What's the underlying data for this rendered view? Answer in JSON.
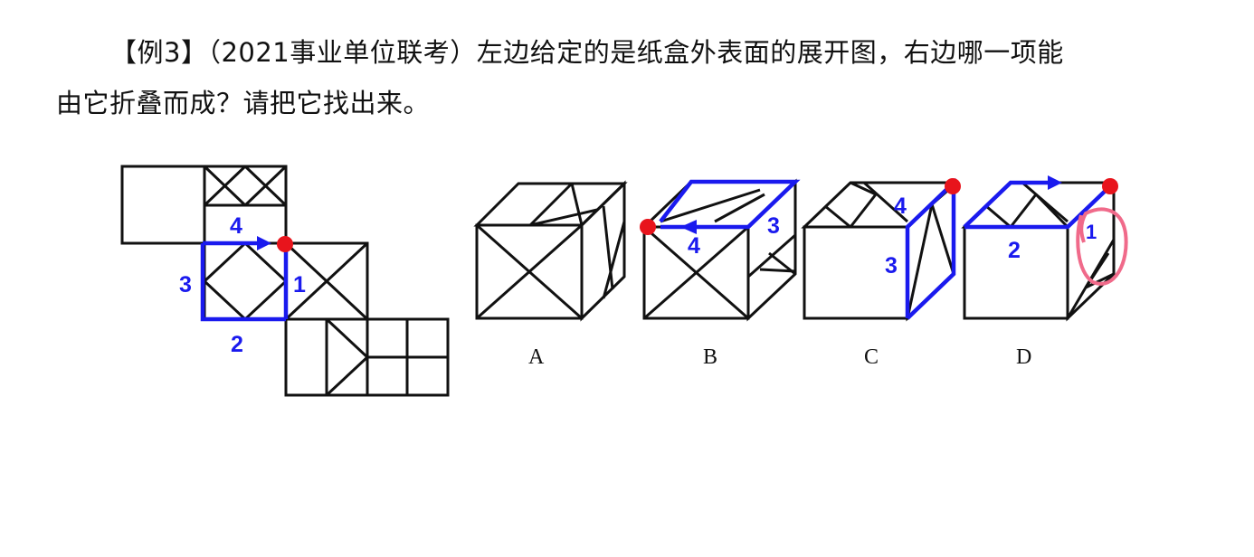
{
  "question": {
    "example_tag": "【例3】",
    "source": "（2021事业单位联考）",
    "text_line1": "左边给定的是纸盒外表面的展开图，右边哪一项能",
    "text_line2": "由它折叠而成？请把它找出来。"
  },
  "net": {
    "edge_labels": [
      "1",
      "2",
      "3",
      "4"
    ]
  },
  "options": [
    {
      "label": "A",
      "edge_labels": []
    },
    {
      "label": "B",
      "edge_labels": [
        "4",
        "3"
      ]
    },
    {
      "label": "C",
      "edge_labels": [
        "4",
        "3"
      ]
    },
    {
      "label": "D",
      "edge_labels": [
        "2",
        "1"
      ]
    }
  ],
  "colors": {
    "line": "#111111",
    "annotation": "#1a1aee",
    "marker": "#e8141c",
    "highlight": "#f06a8a"
  }
}
